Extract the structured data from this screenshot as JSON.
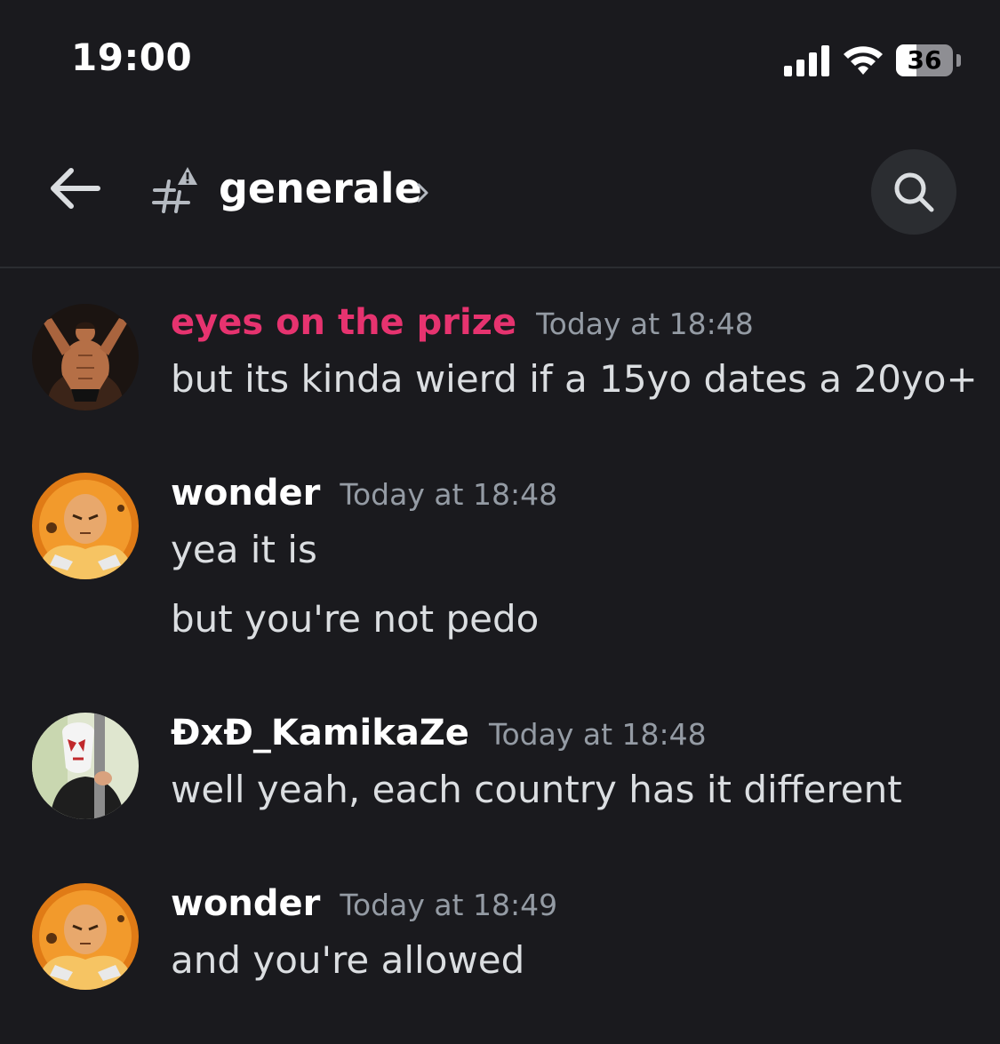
{
  "status_bar": {
    "time": "19:00",
    "battery_percent": "36",
    "battery_level": 0.36
  },
  "header": {
    "channel_name": "generale"
  },
  "messages": [
    {
      "username": "eyes on the prize",
      "username_color": "#e6336f",
      "timestamp": "Today at 18:48",
      "lines": [
        "but its kinda wierd if a 15yo dates a 20yo+"
      ]
    },
    {
      "username": "wonder",
      "username_color": "#ffffff",
      "timestamp": "Today at 18:48",
      "lines": [
        "yea it is",
        "but you're not pedo"
      ]
    },
    {
      "username": "ÐxÐ_KamikaZe",
      "username_color": "#ffffff",
      "timestamp": "Today at 18:48",
      "lines": [
        "well yeah, each country has it different"
      ]
    },
    {
      "username": "wonder",
      "username_color": "#ffffff",
      "timestamp": "Today at 18:49",
      "lines": [
        "and you're allowed"
      ]
    }
  ]
}
